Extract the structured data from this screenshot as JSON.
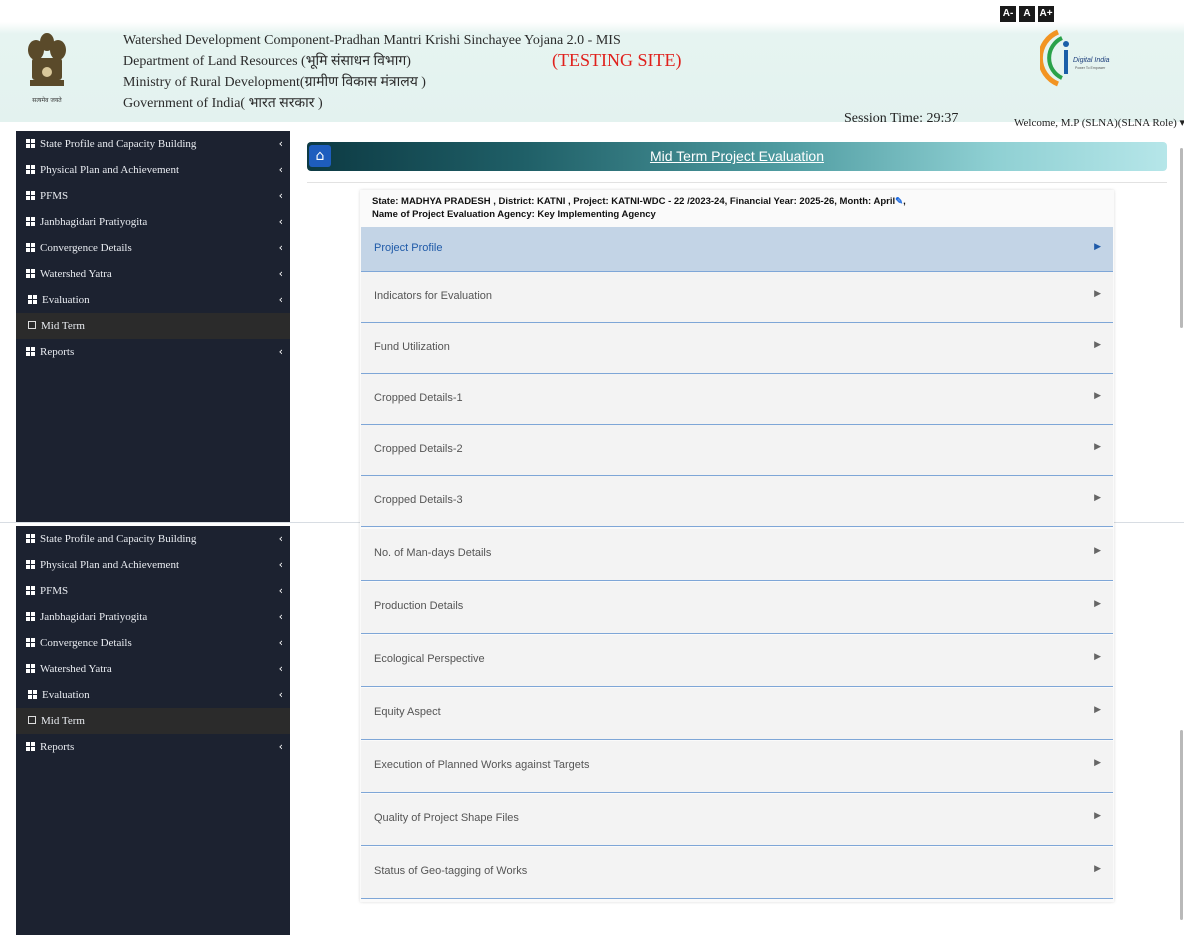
{
  "header": {
    "font_controls": [
      "A-",
      "A",
      "A+"
    ],
    "lines": [
      "Watershed Development Component-Pradhan Mantri Krishi Sinchayee Yojana 2.0 - MIS",
      "Department of Land Resources (भूमि संसाधन विभाग)",
      "Ministry of Rural Development(ग्रामीण विकास मंत्रालय )",
      "Government of India( भारत सरकार )"
    ],
    "testing_label": "(TESTING SITE)",
    "emblem_caption": "सत्यमेव जयते",
    "digital_india_label": "Digital India",
    "digital_india_tagline": "Power To Empower",
    "session_time": "Session Time: 29:37",
    "welcome": "Welcome, M.P (SLNA)(SLNA Role) ▾"
  },
  "sidebar": {
    "items": [
      {
        "label": "State Profile and Capacity Building"
      },
      {
        "label": "Physical Plan and Achievement"
      },
      {
        "label": "PFMS"
      },
      {
        "label": "Janbhagidari Pratiyogita"
      },
      {
        "label": "Convergence Details"
      },
      {
        "label": "Watershed Yatra"
      },
      {
        "label": "Evaluation"
      }
    ],
    "leaf": "Mid Term",
    "reports": "Reports"
  },
  "page": {
    "title": "Mid Term Project Evaluation",
    "info_line1": "State:  MADHYA PRADESH ,    District:  KATNI ,    Project:  KATNI-WDC - 22 /2023-24,    Financial Year:  2025-26,    Month:  April",
    "info_line1_suffix": ",",
    "info_line2": "Name of Project Evaluation Agency:  Key Implementing Agency"
  },
  "sections": [
    "Project Profile",
    "Indicators for Evaluation",
    "Fund Utilization",
    "Cropped Details-1",
    "Cropped Details-2",
    "Cropped Details-3",
    "No. of Man-days Details",
    "Production Details",
    "Ecological Perspective",
    "Equity Aspect",
    "Execution of Planned Works against Targets",
    "Quality of Project Shape Files",
    "Status of Geo-tagging of Works"
  ],
  "colors": {
    "sidebar_bg": "#1c2230",
    "active_section": "#c3d4e6",
    "testing_red": "#e0201c",
    "accent_blue": "#1e5dbe"
  }
}
